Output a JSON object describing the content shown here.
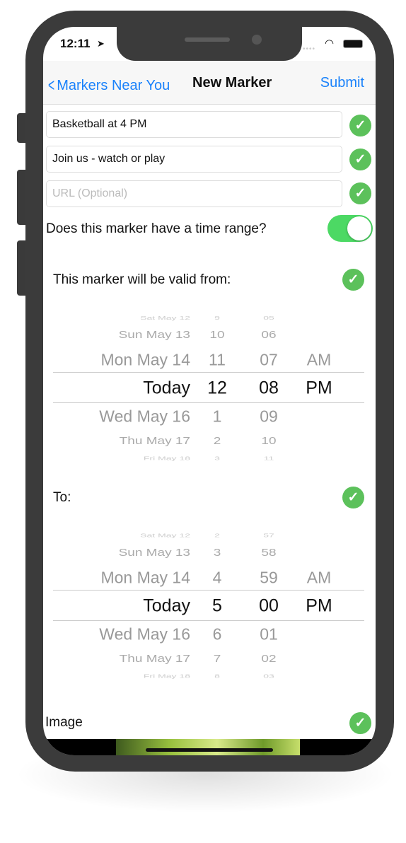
{
  "status_bar": {
    "time": "12:11",
    "location_icon": "location-arrow-icon",
    "wifi_icon": "wifi-icon",
    "battery_icon": "battery-icon"
  },
  "nav": {
    "back_label": "Markers Near You",
    "title": "New Marker",
    "submit_label": "Submit"
  },
  "form": {
    "title_value": "Basketball at 4 PM",
    "description_value": "Join us - watch or play",
    "url_placeholder": "URL (Optional)",
    "time_range_label": "Does this marker have a time range?",
    "time_range_on": true,
    "from_label": "This marker will be valid from:",
    "to_label": "To:",
    "image_label": "Image"
  },
  "colors": {
    "accent": "#1a82fb",
    "check": "#5cc15b",
    "toggle_on": "#4cd964"
  },
  "pickers": [
    {
      "rows": [
        {
          "date": "Sat May 12",
          "hour": "9",
          "minute": "05",
          "ampm": ""
        },
        {
          "date": "Sun May 13",
          "hour": "10",
          "minute": "06",
          "ampm": ""
        },
        {
          "date": "Mon May 14",
          "hour": "11",
          "minute": "07",
          "ampm": "AM"
        },
        {
          "date": "Today",
          "hour": "12",
          "minute": "08",
          "ampm": "PM"
        },
        {
          "date": "Wed May 16",
          "hour": "1",
          "minute": "09",
          "ampm": ""
        },
        {
          "date": "Thu May 17",
          "hour": "2",
          "minute": "10",
          "ampm": ""
        },
        {
          "date": "Fri May 18",
          "hour": "3",
          "minute": "11",
          "ampm": ""
        }
      ]
    },
    {
      "rows": [
        {
          "date": "Sat May 12",
          "hour": "2",
          "minute": "57",
          "ampm": ""
        },
        {
          "date": "Sun May 13",
          "hour": "3",
          "minute": "58",
          "ampm": ""
        },
        {
          "date": "Mon May 14",
          "hour": "4",
          "minute": "59",
          "ampm": "AM"
        },
        {
          "date": "Today",
          "hour": "5",
          "minute": "00",
          "ampm": "PM"
        },
        {
          "date": "Wed May 16",
          "hour": "6",
          "minute": "01",
          "ampm": ""
        },
        {
          "date": "Thu May 17",
          "hour": "7",
          "minute": "02",
          "ampm": ""
        },
        {
          "date": "Fri May 18",
          "hour": "8",
          "minute": "03",
          "ampm": ""
        }
      ]
    }
  ]
}
